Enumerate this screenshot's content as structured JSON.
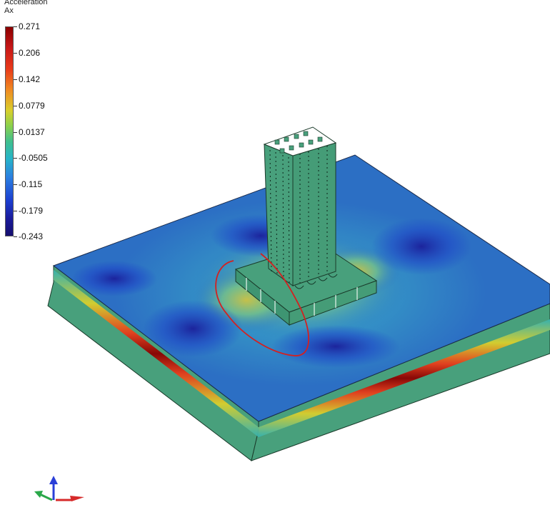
{
  "legend": {
    "title_line1": "Acceleration",
    "title_line2": "Ax",
    "ticks": [
      "0.271",
      "0.206",
      "0.142",
      "0.0779",
      "0.0137",
      "-0.0505",
      "-0.115",
      "-0.179",
      "-0.243"
    ]
  },
  "colors": {
    "colormap": [
      "#8b0000",
      "#e83a1a",
      "#f08a22",
      "#d9cf2c",
      "#3fbf8f",
      "#27b4c8",
      "#2b7fe0",
      "#1c3fd0",
      "#150f6e"
    ],
    "model_body": "#48a07c",
    "ground_surface": "#2c6fc4",
    "annotation": "#d42020"
  },
  "axes_triad": {
    "x_axis_color": "#d62a2a",
    "y_axis_color": "#2aa84a",
    "z_axis_color": "#2a3fd8"
  }
}
